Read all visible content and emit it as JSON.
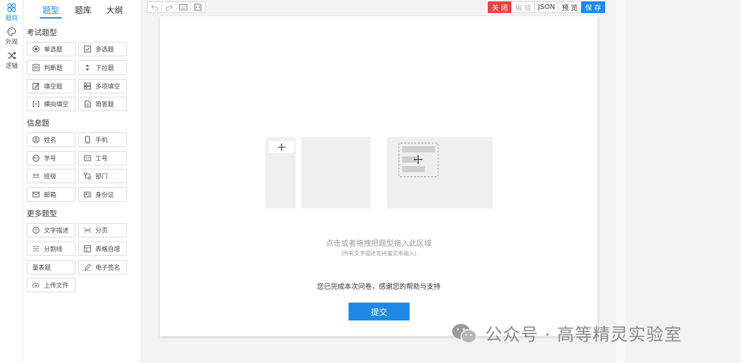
{
  "rail": [
    {
      "label": "题目",
      "icon": "grid-icon",
      "active": true
    },
    {
      "label": "外观",
      "icon": "palette-icon",
      "active": false
    },
    {
      "label": "逻辑",
      "icon": "shuffle-icon",
      "active": false
    }
  ],
  "tabs": [
    "题型",
    "题库",
    "大纲"
  ],
  "sections": {
    "exam": "考试题型",
    "info": "信息题",
    "more": "更多题型"
  },
  "exam_tiles": [
    {
      "label": "单选题",
      "icon": "radio-icon"
    },
    {
      "label": "多选题",
      "icon": "checkbox-icon"
    },
    {
      "label": "判断题",
      "icon": "judge-icon"
    },
    {
      "label": "下拉题",
      "icon": "dropdown-icon"
    },
    {
      "label": "填空题",
      "icon": "edit-icon"
    },
    {
      "label": "多项填空",
      "icon": "multi-fill-icon"
    },
    {
      "label": "横向填空",
      "icon": "bracket-icon"
    },
    {
      "label": "简答题",
      "icon": "document-icon"
    }
  ],
  "info_tiles": [
    {
      "label": "姓名",
      "icon": "user-icon"
    },
    {
      "label": "手机",
      "icon": "phone-icon"
    },
    {
      "label": "学号",
      "icon": "student-id-icon"
    },
    {
      "label": "工号",
      "icon": "badge-icon"
    },
    {
      "label": "班级",
      "icon": "class-icon"
    },
    {
      "label": "部门",
      "icon": "department-icon"
    },
    {
      "label": "邮箱",
      "icon": "mail-icon"
    },
    {
      "label": "身份证",
      "icon": "idcard-icon"
    }
  ],
  "more_tiles": [
    {
      "label": "文字描述",
      "icon": "info-icon"
    },
    {
      "label": "分页",
      "icon": "pagination-icon"
    },
    {
      "label": "分割线",
      "icon": "divider-icon"
    },
    {
      "label": "表格自增",
      "icon": "table-icon"
    },
    {
      "label": "量表题",
      "icon": ""
    },
    {
      "label": "电子签名",
      "icon": "pen-icon"
    },
    {
      "label": "上传文件",
      "icon": "upload-icon"
    }
  ],
  "toolbar": {
    "tools": [
      "undo-icon",
      "redo-icon",
      "keyboard-icon",
      "code-icon"
    ],
    "close": "关 闭",
    "edit": "编 辑",
    "json": "JSON",
    "preview": "预 览",
    "save": "保 存"
  },
  "canvas": {
    "drop_hint": "点击或者拖拽把题型拖入此区域",
    "drop_sub": "(所有文字描述支持富文本输入)",
    "done": "您已完成本次问卷，感谢您的帮助与支持",
    "submit": "提交"
  },
  "watermark": "公众号 · 高等精灵实验室",
  "colors": {
    "accent": "#1e88e5",
    "danger": "#e64545"
  }
}
